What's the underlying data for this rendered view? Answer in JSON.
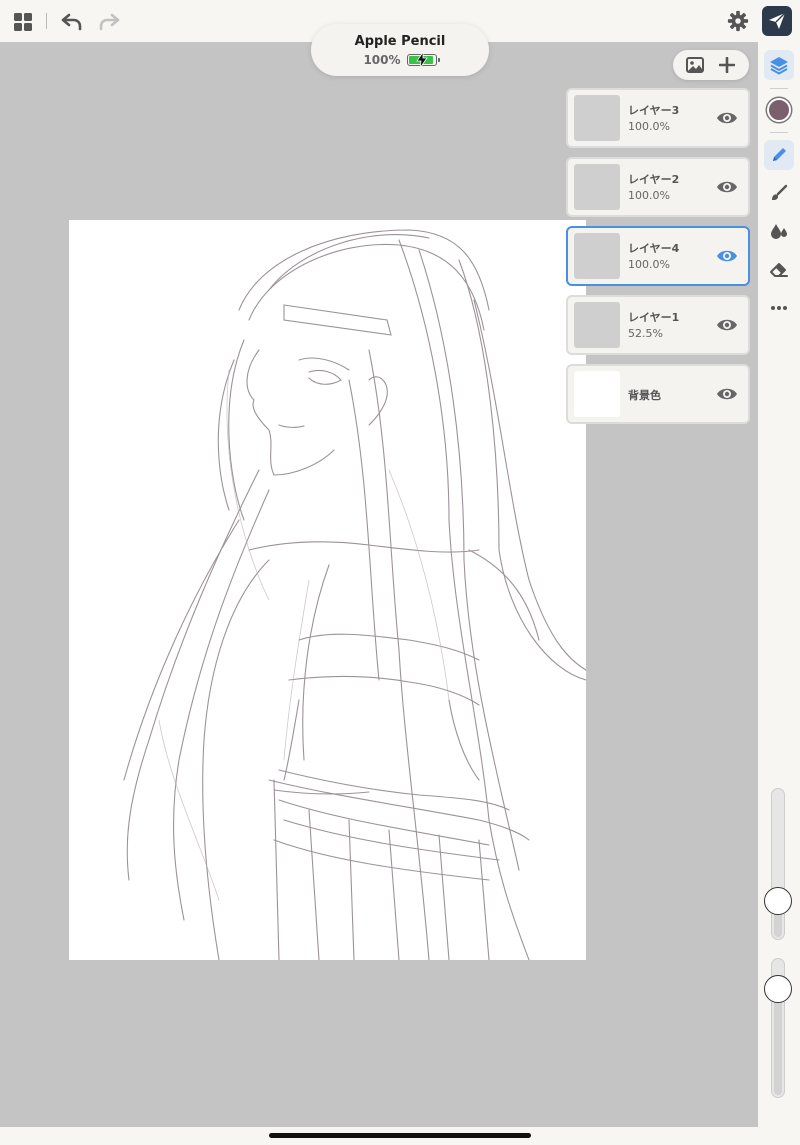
{
  "toolbar": {
    "grid_icon": "grid-icon",
    "undo_icon": "undo-icon",
    "redo_icon": "redo-icon",
    "settings_icon": "gear-icon",
    "send_icon": "paper-plane-icon"
  },
  "pencil_status": {
    "name": "Apple Pencil",
    "battery_percent": "100%",
    "battery_level": 1.0,
    "battery_color": "#37c24a"
  },
  "layers": [
    {
      "name": "レイヤー3",
      "opacity": "100.0%",
      "visible": true,
      "active": false
    },
    {
      "name": "レイヤー2",
      "opacity": "100.0%",
      "visible": true,
      "active": false
    },
    {
      "name": "レイヤー4",
      "opacity": "100.0%",
      "visible": true,
      "active": true
    },
    {
      "name": "レイヤー1",
      "opacity": "52.5%",
      "visible": true,
      "active": false
    },
    {
      "name": "背景色",
      "visible": true,
      "active": false
    }
  ],
  "tools": {
    "layers": "layers-icon",
    "color": "#7a5f6d",
    "pencil": "pencil-icon",
    "brush": "brush-icon",
    "blend": "drops-icon",
    "eraser": "eraser-icon",
    "more": "more-icon"
  },
  "sliders": {
    "brush_size_level": 0.2,
    "opacity_level": 0.85
  },
  "colors": {
    "accent": "#4a90e2",
    "workspace": "#c4c4c4",
    "send_button": "#2d3a4b"
  }
}
